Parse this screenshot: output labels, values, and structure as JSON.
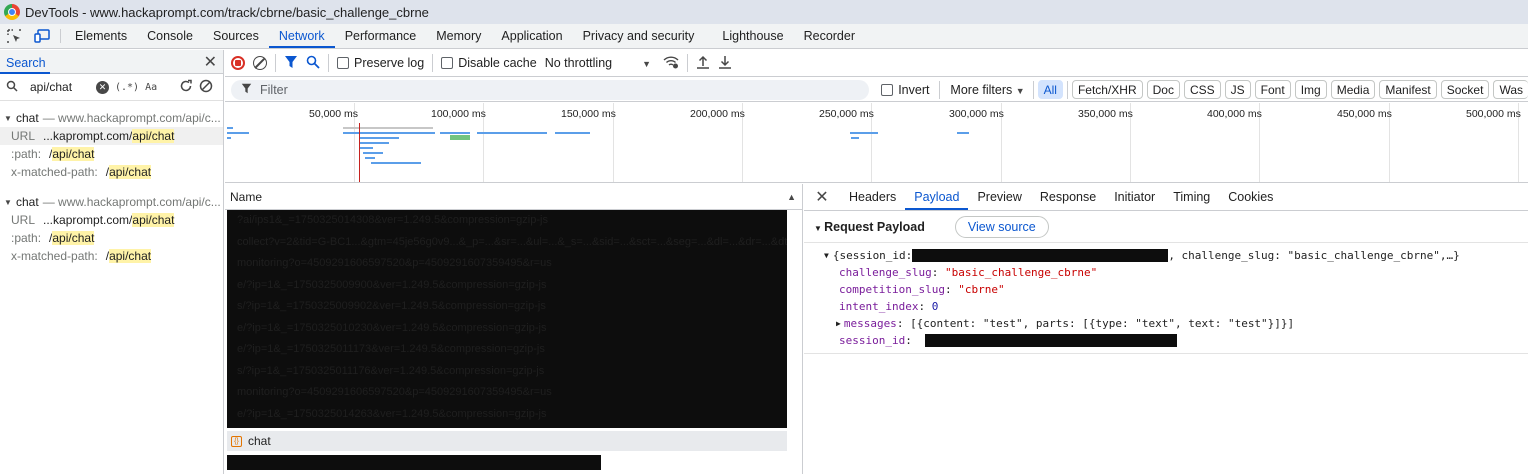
{
  "window": {
    "title": "DevTools - www.hackaprompt.com/track/cbrne/basic_challenge_cbrne"
  },
  "panel_tabs": [
    "Elements",
    "Console",
    "Sources",
    "Network",
    "Performance",
    "Memory",
    "Application",
    "Privacy and security",
    "Lighthouse",
    "Recorder"
  ],
  "active_panel": "Network",
  "search_panel": {
    "title": "Search",
    "query": "api/chat",
    "regex_label": "(.*)",
    "case_label": "Aa",
    "results": [
      {
        "name": "chat",
        "dash": "— www.hackaprompt.com/api/c...",
        "lines": [
          {
            "key": "URL",
            "prefix": "...kaprompt.com/",
            "match": "api/chat",
            "selected": true
          },
          {
            "key": ":path:",
            "prefix": "/",
            "match": "api/chat",
            "selected": false
          },
          {
            "key": "x-matched-path:",
            "prefix": "/",
            "match": "api/chat",
            "selected": false
          }
        ]
      },
      {
        "name": "chat",
        "dash": "— www.hackaprompt.com/api/c...",
        "lines": [
          {
            "key": "URL",
            "prefix": "...kaprompt.com/",
            "match": "api/chat",
            "selected": false
          },
          {
            "key": ":path:",
            "prefix": "/",
            "match": "api/chat",
            "selected": false
          },
          {
            "key": "x-matched-path:",
            "prefix": "/",
            "match": "api/chat",
            "selected": false
          }
        ]
      }
    ]
  },
  "toolbar": {
    "preserve_log": "Preserve log",
    "disable_cache": "Disable cache",
    "throttling": "No throttling"
  },
  "filter": {
    "placeholder": "Filter",
    "invert": "Invert",
    "more_filters": "More filters",
    "chips": [
      "All",
      "Fetch/XHR",
      "Doc",
      "CSS",
      "JS",
      "Font",
      "Img",
      "Media",
      "Manifest",
      "Socket",
      "Was"
    ]
  },
  "overview": {
    "ticks": [
      "50,000 ms",
      "100,000 ms",
      "150,000 ms",
      "200,000 ms",
      "250,000 ms",
      "300,000 ms",
      "350,000 ms",
      "400,000 ms",
      "450,000 ms",
      "500,000 ms"
    ]
  },
  "requests": {
    "column_name": "Name",
    "rows": [
      "?ai/ips1&_=1750325014308&ver=1.249.5&compression=gzip-js",
      "collect?v=2&tid=G-BC1...&gtm=45je56g0v9...&_p=...&sr=...&ul=...&_s=...&sid=...&sct=...&seg=...&dl=...&dr=...&dt=...&en=form_field_interaction&_et=...",
      "monitoring?o=4509291606597520&p=4509291607359495&r=us",
      "e/?ip=1&_=1750325009900&ver=1.249.5&compression=gzip-js",
      "s/?ip=1&_=1750325009902&ver=1.249.5&compression=gzip-js",
      "e/?ip=1&_=1750325010230&ver=1.249.5&compression=gzip-js",
      "e/?ip=1&_=1750325011173&ver=1.249.5&compression=gzip-js",
      "s/?ip=1&_=1750325011176&ver=1.249.5&compression=gzip-js",
      "monitoring?o=4509291606597520&p=4509291607359495&r=us",
      "e/?ip=1&_=1750325014263&ver=1.249.5&compression=gzip-js",
      "s/?ip=1&_=1750325014308&ver=1.249.5&compression=gzip-js"
    ],
    "selected": "chat"
  },
  "details": {
    "tabs": [
      "Headers",
      "Payload",
      "Preview",
      "Response",
      "Initiator",
      "Timing",
      "Cookies"
    ],
    "active_tab": "Payload",
    "section_title": "Request Payload",
    "view_source": "View source",
    "summary_open": "{session_id: ",
    "summary_rest": ", challenge_slug: \"basic_challenge_cbrne\",…}",
    "fields": [
      {
        "key": "challenge_slug",
        "value": "\"basic_challenge_cbrne\"",
        "type": "string"
      },
      {
        "key": "competition_slug",
        "value": "\"cbrne\"",
        "type": "string"
      },
      {
        "key": "intent_index",
        "value": "0",
        "type": "number"
      },
      {
        "key": "messages",
        "value": "[{content: \"test\", parts: [{type: \"text\", text: \"test\"}]}]",
        "type": "array"
      },
      {
        "key": "session_id",
        "value": "",
        "type": "redacted"
      }
    ]
  },
  "colors": {
    "accent": "#0b57d0",
    "string": "#c80000",
    "key": "#7a1d9b",
    "number": "#1a1aa6",
    "highlight": "#fff3a8",
    "record": "#d93025"
  }
}
